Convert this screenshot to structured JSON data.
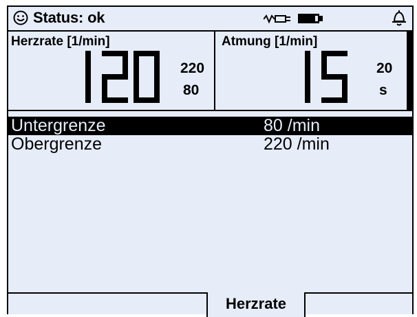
{
  "status": {
    "text": "Status: ok",
    "mood_icon": "smiley-icon",
    "power_icon": "plug-icon",
    "battery_icon": "battery-icon",
    "alarm_icon": "bell-icon"
  },
  "vitals": [
    {
      "label": "Herzrate [1/min]",
      "value": "120",
      "upper_limit": "220",
      "lower_limit": "80"
    },
    {
      "label": "Atmung [1/min]",
      "value": "15",
      "upper_limit": "20",
      "lower_limit": "s"
    }
  ],
  "menu": {
    "items": [
      {
        "label": "Untergrenze",
        "value": "80 /min",
        "selected": true
      },
      {
        "label": "Obergrenze",
        "value": "220 /min",
        "selected": false
      }
    ]
  },
  "tabs": {
    "active_label": "Herzrate"
  },
  "colors": {
    "background": "#e6ecf8",
    "foreground": "#000000"
  }
}
